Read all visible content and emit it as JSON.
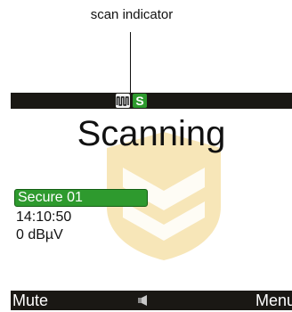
{
  "annotation": {
    "label": "scan indicator"
  },
  "status_bar": {
    "scan_icon": "scan-wave-icon",
    "secure_icon": {
      "name": "secure-mode-icon",
      "text": "S",
      "color": "#2e9a2e"
    }
  },
  "main": {
    "title": "Scanning",
    "channel": "Secure 01",
    "time": "14:10:50",
    "signal": "0 dBµV"
  },
  "softkeys": {
    "left": "Mute",
    "center_icon": "speaker-icon",
    "right": "Menu"
  },
  "colors": {
    "bar_background": "#1a1814",
    "accent_green": "#2e9a2e",
    "watermark": "#f7e6b8"
  }
}
